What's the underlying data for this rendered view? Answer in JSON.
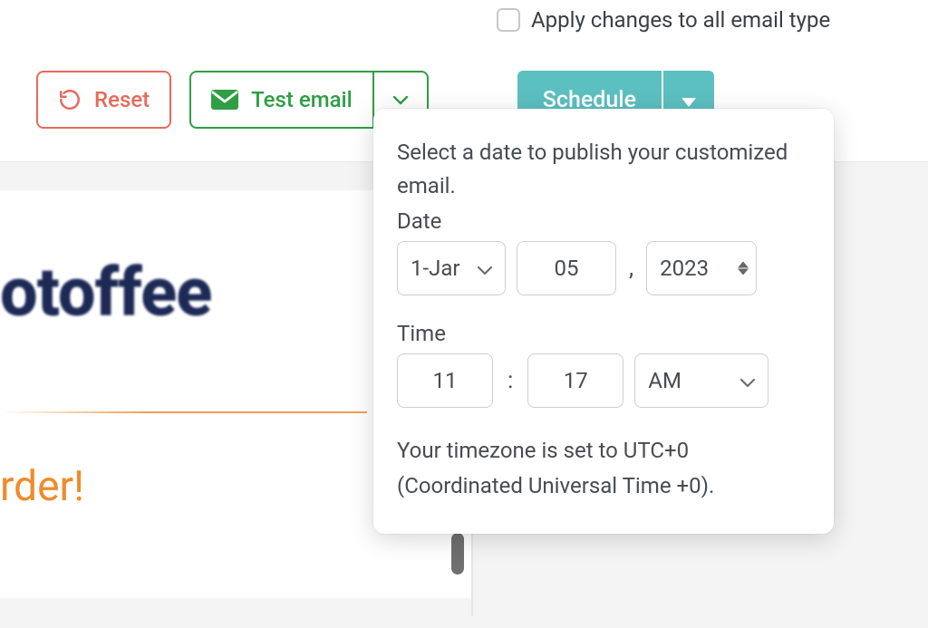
{
  "header": {
    "apply_all_label": "Apply changes to all email type",
    "apply_all_checked": false,
    "reset_label": "Reset",
    "test_email_label": "Test email",
    "schedule_label": "Schedule"
  },
  "popover": {
    "prompt": "Select a date to publish your customized email.",
    "date_label": "Date",
    "time_label": "Time",
    "month_value": "1-Jar",
    "day_value": "05",
    "year_value": "2023",
    "hour_value": "11",
    "minute_value": "17",
    "ampm_value": "AM",
    "timezone_text": "Your timezone is set to UTC+0 (Coordinated Universal Time +0)."
  },
  "preview": {
    "brand_fragment": "otoffee",
    "headline_fragment": "rder!"
  },
  "colors": {
    "reset": "#E76A5B",
    "test": "#2F9E44",
    "schedule": "#5CBFC0",
    "brand_navy": "#1d2a56",
    "accent_orange": "#ef8b2c"
  }
}
